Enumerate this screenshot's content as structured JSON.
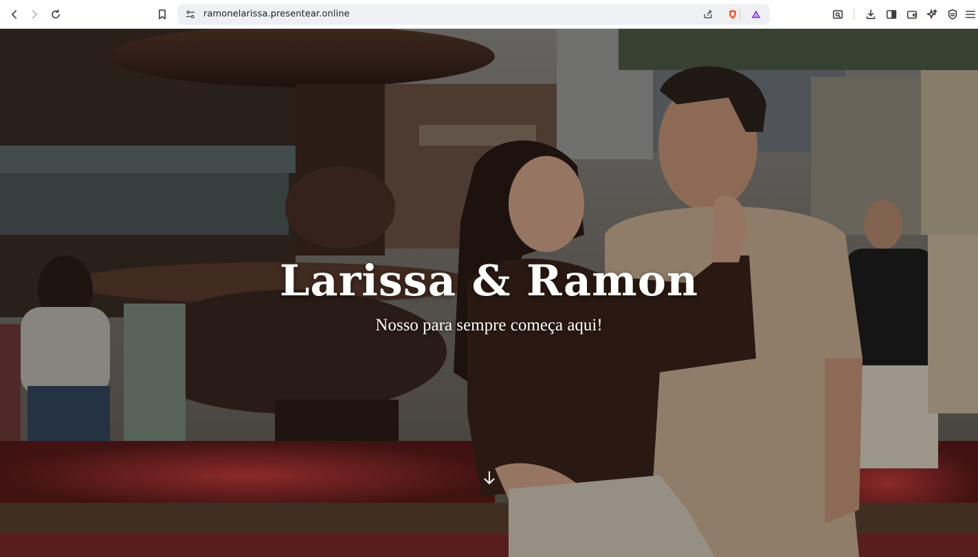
{
  "browser": {
    "url": "ramonelarissa.presentear.online",
    "nav_icons": [
      "back-icon",
      "forward-icon",
      "reload-icon",
      "bookmark-icon"
    ],
    "url_icons": [
      "site-settings-icon",
      "share-icon",
      "brave-shields-icon",
      "brave-rewards-icon"
    ],
    "toolbar_icons": [
      "page-search-icon",
      "downloads-icon",
      "sidebar-icon",
      "wallet-icon",
      "leo-ai-icon",
      "vpn-shield-icon",
      "menu-icon"
    ]
  },
  "hero": {
    "title": "Larissa & Ramon",
    "subtitle": "Nosso para sempre começa aqui!",
    "scroll_icon": "arrow-down-icon"
  },
  "colors": {
    "hero_text": "#ffffff",
    "hero_background": "#3b2e26",
    "brave_orange": "#fb542b",
    "rewards_purple": "#7b3fe4"
  }
}
